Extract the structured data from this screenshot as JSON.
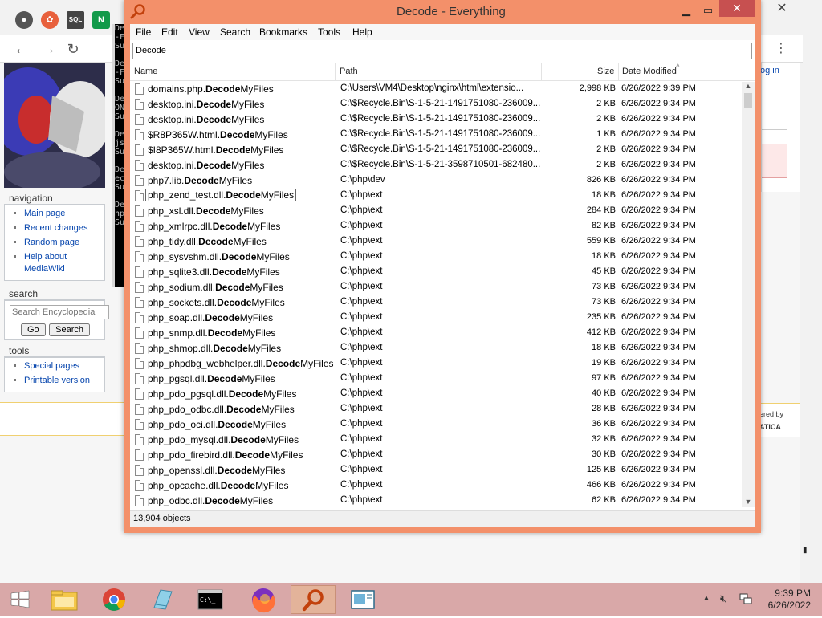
{
  "background_browser": {
    "bookmark_icons": [
      "web-icon",
      "maple-icon",
      "sql-icon",
      "nginx-icon"
    ],
    "sql_icon_text": "SQL",
    "nginx_icon_text": "N",
    "login_text": "og in",
    "powered_by": "ered by",
    "powered_by_brand": "ATICA",
    "sidebar": {
      "navigation_heading": "navigation",
      "navigation_items": [
        "Main page",
        "Recent changes",
        "Random page",
        "Help about MediaWiki"
      ],
      "search_heading": "search",
      "search_placeholder": "Search Encyclopedia",
      "go_label": "Go",
      "search_label": "Search",
      "tools_heading": "tools",
      "tools_items": [
        "Special pages",
        "Printable version"
      ]
    },
    "cmd_lines": [
      "De",
      "-F",
      "Su",
      "",
      "De",
      "-F",
      "Su",
      "",
      "De",
      "ON",
      "Su",
      "",
      "De",
      "js",
      "Su",
      "",
      "De",
      "ec",
      "Su",
      "",
      "De",
      "hp",
      "Su"
    ]
  },
  "everything": {
    "title": "Decode - Everything",
    "menu": [
      "File",
      "Edit",
      "View",
      "Search",
      "Bookmarks",
      "Tools",
      "Help"
    ],
    "search_value": "Decode",
    "columns": {
      "name": "Name",
      "path": "Path",
      "size": "Size",
      "date": "Date Modified"
    },
    "rows": [
      {
        "pre": "domains.php.",
        "match": "Decode",
        "post": "MyFiles",
        "path": "C:\\Users\\VM4\\Desktop\\nginx\\html\\extensio...",
        "size": "2,998 KB",
        "date": "6/26/2022 9:39 PM"
      },
      {
        "pre": "desktop.ini.",
        "match": "Decode",
        "post": "MyFiles",
        "path": "C:\\$Recycle.Bin\\S-1-5-21-1491751080-236009...",
        "size": "2 KB",
        "date": "6/26/2022 9:34 PM"
      },
      {
        "pre": "desktop.ini.",
        "match": "Decode",
        "post": "MyFiles",
        "path": "C:\\$Recycle.Bin\\S-1-5-21-1491751080-236009...",
        "size": "2 KB",
        "date": "6/26/2022 9:34 PM"
      },
      {
        "pre": "$R8P365W.html.",
        "match": "Decode",
        "post": "MyFiles",
        "path": "C:\\$Recycle.Bin\\S-1-5-21-1491751080-236009...",
        "size": "1 KB",
        "date": "6/26/2022 9:34 PM"
      },
      {
        "pre": "$I8P365W.html.",
        "match": "Decode",
        "post": "MyFiles",
        "path": "C:\\$Recycle.Bin\\S-1-5-21-1491751080-236009...",
        "size": "2 KB",
        "date": "6/26/2022 9:34 PM"
      },
      {
        "pre": "desktop.ini.",
        "match": "Decode",
        "post": "MyFiles",
        "path": "C:\\$Recycle.Bin\\S-1-5-21-3598710501-682480...",
        "size": "2 KB",
        "date": "6/26/2022 9:34 PM"
      },
      {
        "pre": "php7.lib.",
        "match": "Decode",
        "post": "MyFiles",
        "path": "C:\\php\\dev",
        "size": "826 KB",
        "date": "6/26/2022 9:34 PM"
      },
      {
        "pre": "php_zend_test.dll.",
        "match": "Decode",
        "post": "MyFiles",
        "path": "C:\\php\\ext",
        "size": "18 KB",
        "date": "6/26/2022 9:34 PM"
      },
      {
        "pre": "php_xsl.dll.",
        "match": "Decode",
        "post": "MyFiles",
        "path": "C:\\php\\ext",
        "size": "284 KB",
        "date": "6/26/2022 9:34 PM"
      },
      {
        "pre": "php_xmlrpc.dll.",
        "match": "Decode",
        "post": "MyFiles",
        "path": "C:\\php\\ext",
        "size": "82 KB",
        "date": "6/26/2022 9:34 PM"
      },
      {
        "pre": "php_tidy.dll.",
        "match": "Decode",
        "post": "MyFiles",
        "path": "C:\\php\\ext",
        "size": "559 KB",
        "date": "6/26/2022 9:34 PM"
      },
      {
        "pre": "php_sysvshm.dll.",
        "match": "Decode",
        "post": "MyFiles",
        "path": "C:\\php\\ext",
        "size": "18 KB",
        "date": "6/26/2022 9:34 PM"
      },
      {
        "pre": "php_sqlite3.dll.",
        "match": "Decode",
        "post": "MyFiles",
        "path": "C:\\php\\ext",
        "size": "45 KB",
        "date": "6/26/2022 9:34 PM"
      },
      {
        "pre": "php_sodium.dll.",
        "match": "Decode",
        "post": "MyFiles",
        "path": "C:\\php\\ext",
        "size": "73 KB",
        "date": "6/26/2022 9:34 PM"
      },
      {
        "pre": "php_sockets.dll.",
        "match": "Decode",
        "post": "MyFiles",
        "path": "C:\\php\\ext",
        "size": "73 KB",
        "date": "6/26/2022 9:34 PM"
      },
      {
        "pre": "php_soap.dll.",
        "match": "Decode",
        "post": "MyFiles",
        "path": "C:\\php\\ext",
        "size": "235 KB",
        "date": "6/26/2022 9:34 PM"
      },
      {
        "pre": "php_snmp.dll.",
        "match": "Decode",
        "post": "MyFiles",
        "path": "C:\\php\\ext",
        "size": "412 KB",
        "date": "6/26/2022 9:34 PM"
      },
      {
        "pre": "php_shmop.dll.",
        "match": "Decode",
        "post": "MyFiles",
        "path": "C:\\php\\ext",
        "size": "18 KB",
        "date": "6/26/2022 9:34 PM"
      },
      {
        "pre": "php_phpdbg_webhelper.dll.",
        "match": "Decode",
        "post": "MyFiles",
        "path": "C:\\php\\ext",
        "size": "19 KB",
        "date": "6/26/2022 9:34 PM"
      },
      {
        "pre": "php_pgsql.dll.",
        "match": "Decode",
        "post": "MyFiles",
        "path": "C:\\php\\ext",
        "size": "97 KB",
        "date": "6/26/2022 9:34 PM"
      },
      {
        "pre": "php_pdo_pgsql.dll.",
        "match": "Decode",
        "post": "MyFiles",
        "path": "C:\\php\\ext",
        "size": "40 KB",
        "date": "6/26/2022 9:34 PM"
      },
      {
        "pre": "php_pdo_odbc.dll.",
        "match": "Decode",
        "post": "MyFiles",
        "path": "C:\\php\\ext",
        "size": "28 KB",
        "date": "6/26/2022 9:34 PM"
      },
      {
        "pre": "php_pdo_oci.dll.",
        "match": "Decode",
        "post": "MyFiles",
        "path": "C:\\php\\ext",
        "size": "36 KB",
        "date": "6/26/2022 9:34 PM"
      },
      {
        "pre": "php_pdo_mysql.dll.",
        "match": "Decode",
        "post": "MyFiles",
        "path": "C:\\php\\ext",
        "size": "32 KB",
        "date": "6/26/2022 9:34 PM"
      },
      {
        "pre": "php_pdo_firebird.dll.",
        "match": "Decode",
        "post": "MyFiles",
        "path": "C:\\php\\ext",
        "size": "30 KB",
        "date": "6/26/2022 9:34 PM"
      },
      {
        "pre": "php_openssl.dll.",
        "match": "Decode",
        "post": "MyFiles",
        "path": "C:\\php\\ext",
        "size": "125 KB",
        "date": "6/26/2022 9:34 PM"
      },
      {
        "pre": "php_opcache.dll.",
        "match": "Decode",
        "post": "MyFiles",
        "path": "C:\\php\\ext",
        "size": "466 KB",
        "date": "6/26/2022 9:34 PM"
      },
      {
        "pre": "php_odbc.dll.",
        "match": "Decode",
        "post": "MyFiles",
        "path": "C:\\php\\ext",
        "size": "62 KB",
        "date": "6/26/2022 9:34 PM"
      }
    ],
    "selected_row": 7,
    "status": "13,904 objects"
  },
  "taskbar": {
    "apps": [
      "start-button",
      "file-explorer-icon",
      "chrome-icon",
      "notepad-icon",
      "cmd-icon",
      "firefox-icon",
      "everything-search-icon",
      "document-icon"
    ],
    "active_app": "everything-search-icon",
    "cmd_icon_text": "C:\\_",
    "time": "9:39 PM",
    "date": "6/26/2022"
  },
  "colors": {
    "window_frame": "#f3906a",
    "close_button": "#c75050",
    "taskbar": "#d9a8a8",
    "link": "#0645ad"
  }
}
